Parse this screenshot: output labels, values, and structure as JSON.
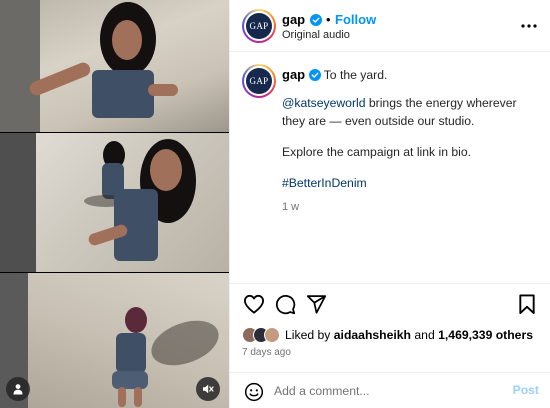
{
  "post": {
    "username": "gap",
    "follow_label": "Follow",
    "separator": "•",
    "audio_label": "Original audio",
    "avatar_text": "GAP"
  },
  "caption": {
    "username": "gap",
    "headline": "To the yard.",
    "mention": "@katseyeworld",
    "line2_rest": " brings the energy wherever they are — even outside our studio.",
    "line3": "Explore the campaign at link in bio.",
    "hashtag": "#BetterInDenim",
    "age": "1 w"
  },
  "likes": {
    "prefix": "Liked by ",
    "user": "aidaahsheikh",
    "middle": " and ",
    "count": "1,469,339 others"
  },
  "date": "7 days ago",
  "comment": {
    "placeholder": "Add a comment...",
    "post_label": "Post"
  },
  "icons": {
    "verified": "verified-badge-icon",
    "more": "more-options-icon",
    "like": "heart-icon",
    "comment": "comment-bubble-icon",
    "share": "paper-plane-icon",
    "save": "bookmark-icon",
    "emoji": "emoji-icon",
    "user_tag": "person-icon",
    "audio": "muted-speaker-icon"
  },
  "colors": {
    "accent": "#0095f6",
    "link": "#00376b",
    "muted": "#737373",
    "post_disabled": "#9dd0fb",
    "avatar_bg": "#16294d"
  }
}
